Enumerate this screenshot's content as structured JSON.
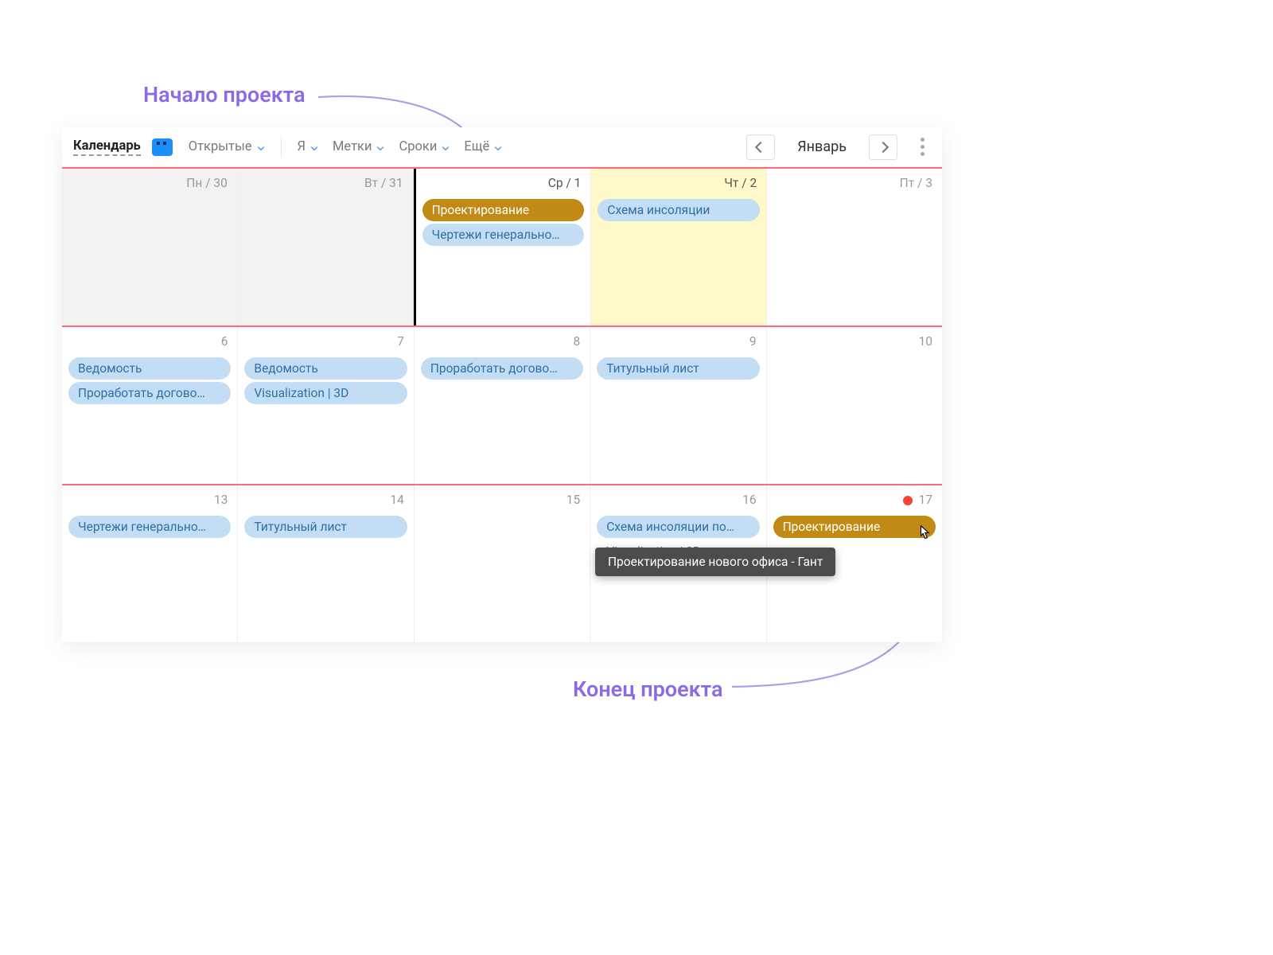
{
  "annotations": {
    "start": "Начало проекта",
    "end": "Конец проекта"
  },
  "toolbar": {
    "title": "Календарь",
    "filters": {
      "open": "Открытые",
      "me": "Я",
      "tags": "Метки",
      "dates": "Сроки",
      "more": "Ещё"
    },
    "month": "Январь"
  },
  "tooltip": "Проектирование нового офиса - Гант",
  "rows": [
    {
      "cells": [
        {
          "label": "Пн / 30",
          "dim": true,
          "items": []
        },
        {
          "label": "Вт / 31",
          "dim": true,
          "items": []
        },
        {
          "label": "Ср / 1",
          "today_edge": true,
          "items": [
            {
              "text": "Проектирование",
              "variant": "amber"
            },
            {
              "text": "Чертежи генерально…",
              "variant": "blue"
            }
          ]
        },
        {
          "label": "Чт / 2",
          "highlight": true,
          "items": [
            {
              "text": "Схема инсоляции",
              "variant": "blue"
            }
          ]
        },
        {
          "label": "Пт / 3",
          "items": []
        }
      ]
    },
    {
      "cells": [
        {
          "label": "6",
          "items": [
            {
              "text": "Ведомость",
              "variant": "blue"
            },
            {
              "text": "Проработать догово…",
              "variant": "blue"
            }
          ]
        },
        {
          "label": "7",
          "items": [
            {
              "text": "Ведомость",
              "variant": "blue"
            },
            {
              "text": "Visualization | 3D",
              "variant": "blue"
            }
          ]
        },
        {
          "label": "8",
          "items": [
            {
              "text": "Проработать догово…",
              "variant": "blue"
            }
          ]
        },
        {
          "label": "9",
          "items": [
            {
              "text": "Титульный лист",
              "variant": "blue"
            }
          ]
        },
        {
          "label": "10",
          "items": []
        }
      ]
    },
    {
      "cells": [
        {
          "label": "13",
          "items": [
            {
              "text": "Чертежи генерально…",
              "variant": "blue"
            }
          ]
        },
        {
          "label": "14",
          "items": [
            {
              "text": "Титульный лист",
              "variant": "blue"
            }
          ]
        },
        {
          "label": "15",
          "items": []
        },
        {
          "label": "16",
          "items": [
            {
              "text": "Схема инсоляции по…",
              "variant": "blue"
            }
          ],
          "ghost": "Visualization | 3D-ren"
        },
        {
          "label": "17",
          "red_dot": true,
          "items": [
            {
              "text": "Проектирование",
              "variant": "amber"
            }
          ]
        }
      ]
    }
  ]
}
